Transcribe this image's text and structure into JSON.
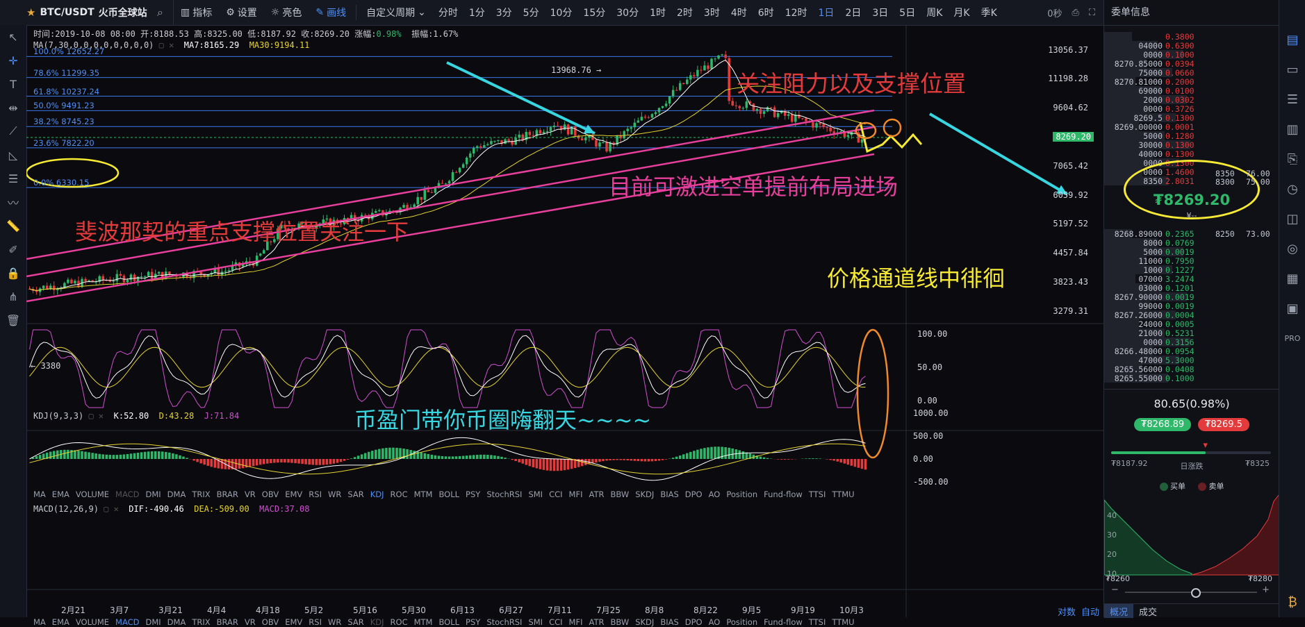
{
  "topbar": {
    "symbol": "BTC/USDT",
    "exchange": "火币全球站",
    "tools": [
      "指标",
      "设置",
      "亮色",
      "画线"
    ],
    "custom_period": "自定义周期",
    "periods": [
      "分时",
      "1分",
      "3分",
      "5分",
      "10分",
      "15分",
      "30分",
      "1时",
      "2时",
      "3时",
      "4时",
      "6时",
      "12时",
      "1日",
      "2日",
      "3日",
      "5日",
      "周K",
      "月K",
      "季K"
    ],
    "active_period": "1日",
    "timer": "0秒"
  },
  "info": {
    "time": "时间:2019-10-08 08:00",
    "open": "开:8188.53",
    "high": "高:8325.00",
    "low": "低:8187.92",
    "close": "收:8269.20",
    "change_label": "涨幅:",
    "change": "0.98%",
    "amp": "振幅:1.67%"
  },
  "ma": {
    "label": "MA(7,30,0,0,0,0,0,0,0,0)",
    "ma7": "MA7:8165.29",
    "ma30": "MA30:9194.11"
  },
  "fib_levels": [
    {
      "label": "100.0% 12652.27",
      "price": 12652.27
    },
    {
      "label": "78.6% 11299.35",
      "price": 11299.35
    },
    {
      "label": "61.8% 10237.24",
      "price": 10237.24
    },
    {
      "label": "50.0% 9491.23",
      "price": 9491.23
    },
    {
      "label": "38.2% 8745.23",
      "price": 8745.23
    },
    {
      "label": "23.6% 7822.20",
      "price": 7822.2
    },
    {
      "label": "0.0% 6330.15",
      "price": 6330.15
    }
  ],
  "price_axis": [
    "13056.37",
    "11198.28",
    "9604.62",
    "8269.20",
    "7065.42",
    "6059.92",
    "5197.52",
    "4457.84",
    "3823.43",
    "3279.31"
  ],
  "current_price": "8269.20",
  "high_mark": "13968.76 →",
  "low_mark": "← 3380",
  "annotations": {
    "resistance": "关注阻力以及支撑位置",
    "short": "目前可激进空单提前布局进场",
    "fib_support": "斐波那契的重点支撑位置关注一下",
    "channel": "价格通道线中徘徊",
    "promo": "币盈门带你币圈嗨翻天~~~~"
  },
  "kdj": {
    "label": "KDJ(9,3,3)",
    "k": "K:52.80",
    "d": "D:43.28",
    "j": "J:71.84",
    "axis": [
      "100.00",
      "50.00",
      "0.00"
    ]
  },
  "macd": {
    "label": "MACD(12,26,9)",
    "dif": "DIF:-490.46",
    "dea": "DEA:-509.00",
    "macd": "MACD:37.08",
    "axis": [
      "1000.00",
      "500.00",
      "0.00",
      "-500.00"
    ]
  },
  "indicator_tabs": [
    "MA",
    "EMA",
    "VOLUME",
    "MACD",
    "DMI",
    "DMA",
    "TRIX",
    "BRAR",
    "VR",
    "OBV",
    "EMV",
    "RSI",
    "WR",
    "SAR",
    "KDJ",
    "ROC",
    "MTM",
    "BOLL",
    "PSY",
    "StochRSI",
    "SMI",
    "CCI",
    "MFI",
    "ATR",
    "BBW",
    "SKDJ",
    "BIAS",
    "DPO",
    "AO",
    "Position",
    "Fund-flow",
    "TTSI",
    "TTMU"
  ],
  "dates": [
    "2月21",
    "3月7",
    "3月21",
    "4月4",
    "4月18",
    "5月2",
    "5月16",
    "5月30",
    "6月13",
    "6月27",
    "7月11",
    "7月25",
    "8月8",
    "8月22",
    "9月5",
    "9月19",
    "10月3"
  ],
  "bottom_right": [
    "对数",
    "自动"
  ],
  "book": {
    "title": "委单信息",
    "asks": [
      {
        "p": "",
        "a": "0.3800"
      },
      {
        "p": "04000",
        "a": "0.6300"
      },
      {
        "p": "0000",
        "a": "0.1000"
      },
      {
        "p": "8270.85000",
        "a": "0.0394"
      },
      {
        "p": "75000",
        "a": "0.0660"
      },
      {
        "p": "8270.81000",
        "a": "0.2000"
      },
      {
        "p": "69000",
        "a": "0.0100"
      },
      {
        "p": "2000",
        "a": "0.0302"
      },
      {
        "p": "0000",
        "a": "0.3726"
      },
      {
        "p": "8269.5",
        "a": "0.1300"
      },
      {
        "p": "8269.00000",
        "a": "0.0001"
      },
      {
        "p": "5000",
        "a": "0.1280"
      },
      {
        "p": "30000",
        "a": "0.1300"
      },
      {
        "p": "40000",
        "a": "0.1300"
      },
      {
        "p": "0000",
        "a": "0.1300"
      },
      {
        "p": "0000",
        "a": "1.4600"
      },
      {
        "p": "8350",
        "a": "2.8031"
      }
    ],
    "ask_side": [
      {
        "p": "8350",
        "a": "76.00"
      },
      {
        "p": "8300",
        "a": "75.00"
      }
    ],
    "big_price": "₮8269.20",
    "cny": "¥--",
    "bids": [
      {
        "p": "8268.89000",
        "a": "0.2365"
      },
      {
        "p": "8000",
        "a": "0.0769"
      },
      {
        "p": "5000",
        "a": "0.0019"
      },
      {
        "p": "11000",
        "a": "0.7950"
      },
      {
        "p": "1000",
        "a": "0.1227"
      },
      {
        "p": "07000",
        "a": "3.2474"
      },
      {
        "p": "03000",
        "a": "0.1201"
      },
      {
        "p": "8267.90000",
        "a": "0.0019"
      },
      {
        "p": "99000",
        "a": "0.0019"
      },
      {
        "p": "8267.26000",
        "a": "0.0004"
      },
      {
        "p": "24000",
        "a": "0.0005"
      },
      {
        "p": "21000",
        "a": "0.5231"
      },
      {
        "p": "0000",
        "a": "0.3156"
      },
      {
        "p": "8266.48000",
        "a": "0.0954"
      },
      {
        "p": "47000",
        "a": "5.3000"
      },
      {
        "p": "8265.56000",
        "a": "0.0408"
      },
      {
        "p": "8265.55000",
        "a": "0.1000"
      }
    ],
    "bid_side": {
      "p": "8250",
      "a": "73.00"
    },
    "change": "80.65(0.98%)",
    "buy_price": "₮8268.89",
    "sell_price": "₮8269.5",
    "low": "₮8187.92",
    "range_label": "日涨跌",
    "high": "₮8325",
    "legend_buy": "买单",
    "legend_sell": "卖单",
    "depth_axis": [
      "40",
      "30",
      "20",
      "10"
    ],
    "depth_low": "₮8260",
    "depth_high": "₮8280",
    "tabs": [
      "概况",
      "成交"
    ],
    "depth_zoom": 0.53
  },
  "colors": {
    "up": "#2fb86a",
    "down": "#e33b3b",
    "accent": "#4f8ff7",
    "ma7": "#ffffff",
    "ma30": "#e6d431",
    "annot_pink": "#e83f9c",
    "annot_cyan": "#37d6e0",
    "annot_yellow": "#f6ea35",
    "annot_red": "#e33b3b",
    "ellipse_orange": "#ef8a2c"
  }
}
